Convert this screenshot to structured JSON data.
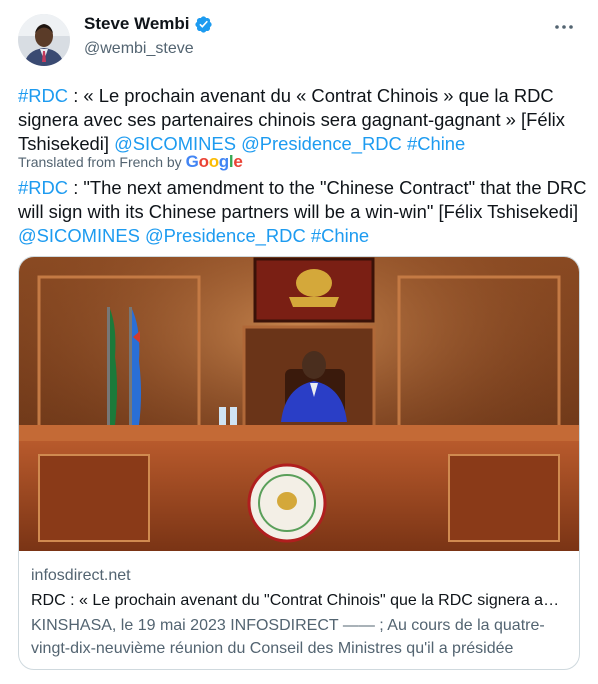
{
  "author": {
    "name": "Steve Wembi",
    "handle": "@wembi_steve"
  },
  "tweet": {
    "original": {
      "hashtag": "#RDC",
      "text": " : « Le prochain avenant du « Contrat Chinois » que la RDC signera avec ses partenaires chinois sera gagnant-gagnant » [Félix Tshisekedi]  ",
      "mention1": "@SICOMINES",
      "mention2": "@Presidence_RDC",
      "tag2": "#Chine"
    },
    "translation_label": "Translated from French by",
    "translation_provider": "Google",
    "translated": {
      "hashtag": "#RDC",
      "text": " : \"The next amendment to the \"Chinese Contract\" that the DRC will sign with its Chinese partners will be a win-win\" [Félix Tshisekedi] ",
      "mention1": "@SICOMINES",
      "mention2": "@Presidence_RDC",
      "tag2": "#Chine"
    }
  },
  "card": {
    "domain": "infosdirect.net",
    "title": "RDC : « Le prochain avenant du \"Contrat Chinois\" que la RDC signera avec ses partenaires chinois sera gagnant-gagnant » [Félix Tshisekedi]",
    "description": "KINSHASA, le 19 mai 2023 INFOSDIRECT —— ; Au cours de la quatre-vingt-dix-neuvième réunion du Conseil des Ministres qu'il a présidée"
  },
  "colors": {
    "link": "#1d9bf0",
    "verified": "#1d9bf0",
    "secondary_text": "#536471"
  },
  "icons": [
    "verified-badge-icon",
    "more-options-icon",
    "google-logo"
  ]
}
